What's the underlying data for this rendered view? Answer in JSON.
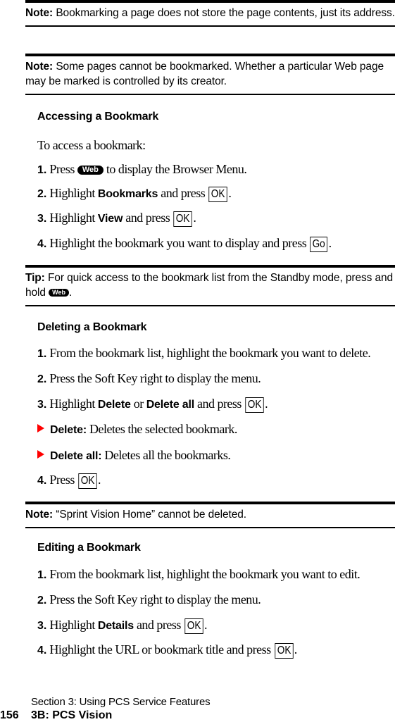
{
  "notes": [
    {
      "label": "Note:",
      "text": " Bookmarking a page does not store the page contents, just its address."
    },
    {
      "label": "Note:",
      "text": " Some pages cannot be bookmarked. Whether a particular Web page may be marked is controlled by its creator."
    },
    {
      "label": "Tip:",
      "text": " For quick access to the bookmark list from the Standby mode, press and hold ",
      "key": "Web",
      "suffix": "."
    },
    {
      "label": "Note:",
      "text": " “Sprint Vision Home” cannot be deleted."
    }
  ],
  "accessing": {
    "heading": "Accessing a Bookmark",
    "intro": "To access a bookmark:",
    "steps": [
      {
        "num": "1.",
        "pre": " Press ",
        "key": "Web",
        "post": " to display the Browser Menu."
      },
      {
        "num": "2.",
        "pre": " Highlight ",
        "bold": "Bookmarks",
        "mid": " and press ",
        "key": "OK",
        "post": "."
      },
      {
        "num": "3.",
        "pre": " Highlight ",
        "bold": "View",
        "mid": " and press ",
        "key": "OK",
        "post": "."
      },
      {
        "num": "4.",
        "pre": " Highlight the bookmark you want to display and press ",
        "key": "Go",
        "post": "."
      }
    ]
  },
  "deleting": {
    "heading": "Deleting a Bookmark",
    "steps": [
      {
        "num": "1.",
        "text": " From the bookmark list, highlight the bookmark you want to delete."
      },
      {
        "num": "2.",
        "text": " Press the Soft Key right to display the menu."
      },
      {
        "num": "3.",
        "pre": " Highlight ",
        "bold1": "Delete",
        "or": " or ",
        "bold2": "Delete all",
        "mid": " and press ",
        "key": "OK",
        "post": "."
      },
      {
        "num": "4.",
        "pre": " Press ",
        "key": "OK",
        "post": "."
      }
    ],
    "bullets": [
      {
        "bold": "Delete:",
        "text": " Deletes the selected bookmark."
      },
      {
        "bold": "Delete all:",
        "text": " Deletes all the bookmarks."
      }
    ]
  },
  "editing": {
    "heading": "Editing a Bookmark",
    "steps": [
      {
        "num": "1.",
        "text": " From the bookmark list, highlight the bookmark you want to edit."
      },
      {
        "num": "2.",
        "text": " Press the Soft Key right to display the menu."
      },
      {
        "num": "3.",
        "pre": " Highlight ",
        "bold": "Details",
        "mid": " and press ",
        "key": "OK",
        "post": "."
      },
      {
        "num": "4.",
        "pre": " Highlight the URL or bookmark title and press ",
        "key": "OK",
        "post": "."
      }
    ]
  },
  "footer": {
    "section": "Section 3: Using PCS Service Features",
    "page_number": "156",
    "chapter": "3B: PCS Vision"
  },
  "colors": {
    "bullet_arrow": "#ff0000",
    "text": "#000000"
  }
}
